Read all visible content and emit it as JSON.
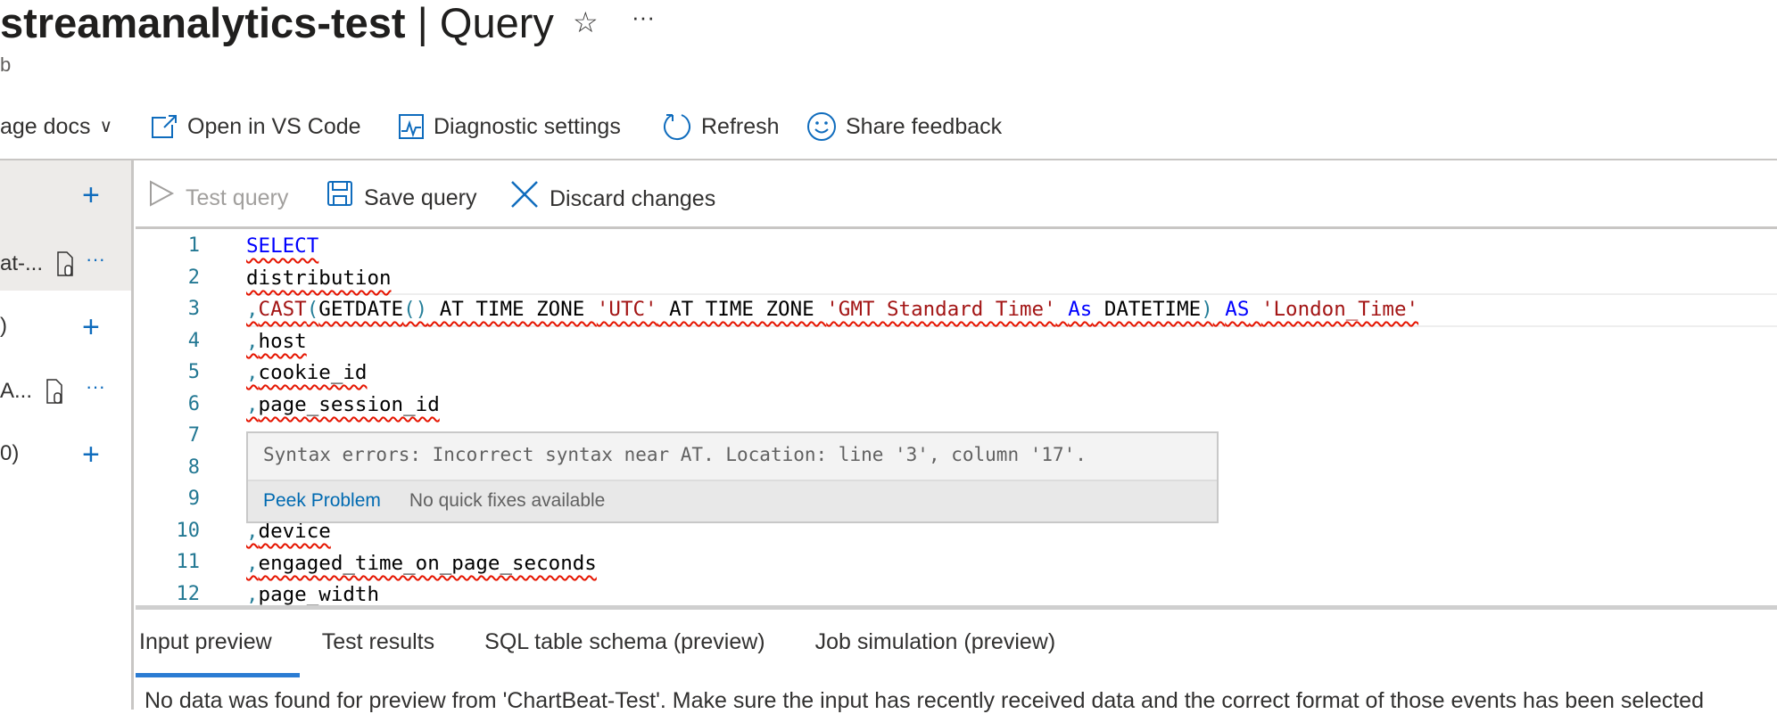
{
  "header": {
    "title_bold": "streamanalytics-test",
    "title_rest": " | Query",
    "subtitle": "b",
    "star_icon": "star-icon",
    "more_icon": "more-icon"
  },
  "toolbar": {
    "items": [
      {
        "label": "age docs",
        "icon": "chevron-down-icon"
      },
      {
        "label": "Open in VS Code",
        "icon": "open-external-icon"
      },
      {
        "label": "Diagnostic settings",
        "icon": "diagnostic-chart-icon"
      },
      {
        "label": "Refresh",
        "icon": "refresh-icon"
      },
      {
        "label": "Share feedback",
        "icon": "smiley-icon"
      }
    ]
  },
  "left_panel": {
    "items": [
      {
        "label": "at-...",
        "selected": true
      },
      {
        "label": ")"
      },
      {
        "label": "A..."
      },
      {
        "label": "0)"
      }
    ]
  },
  "query_toolbar": {
    "test": "Test query",
    "save": "Save query",
    "discard": "Discard changes"
  },
  "editor": {
    "line_numbers": [
      "1",
      "2",
      "3",
      "4",
      "5",
      "6",
      "7",
      "8",
      "9",
      "10",
      "11",
      "12"
    ],
    "lines": {
      "l1": "SELECT",
      "l2": "distribution",
      "l3": [
        ",",
        "CAST",
        "(",
        "GETDATE",
        "()",
        " AT TIME ZONE ",
        "'UTC'",
        " AT TIME ZONE ",
        "'GMT Standard Time'",
        " ",
        "As",
        " DATETIME",
        ")",
        " ",
        "AS",
        " ",
        "'London_Time'"
      ],
      "l4": "host",
      "l5": "cookie_id",
      "l6": "page_session_id",
      "l10": "device",
      "l11": "engaged_time_on_page_seconds",
      "l12": "page_width"
    },
    "comma": ","
  },
  "hover": {
    "message": "Syntax errors: Incorrect syntax near AT. Location: line '3', column '17'.",
    "peek": "Peek Problem",
    "no_fix": "No quick fixes available"
  },
  "bottom": {
    "tabs": [
      "Input preview",
      "Test results",
      "SQL table schema (preview)",
      "Job simulation (preview)"
    ],
    "active_tab": "Input preview",
    "message": "No data was found for preview from 'ChartBeat-Test'. Make sure the input has recently received data and the correct format of those events has been selected"
  },
  "colors": {
    "accent": "#0f6cbd",
    "keyword": "#0000ff",
    "string": "#a31515",
    "error": "#e51400",
    "line_number": "#237893"
  }
}
